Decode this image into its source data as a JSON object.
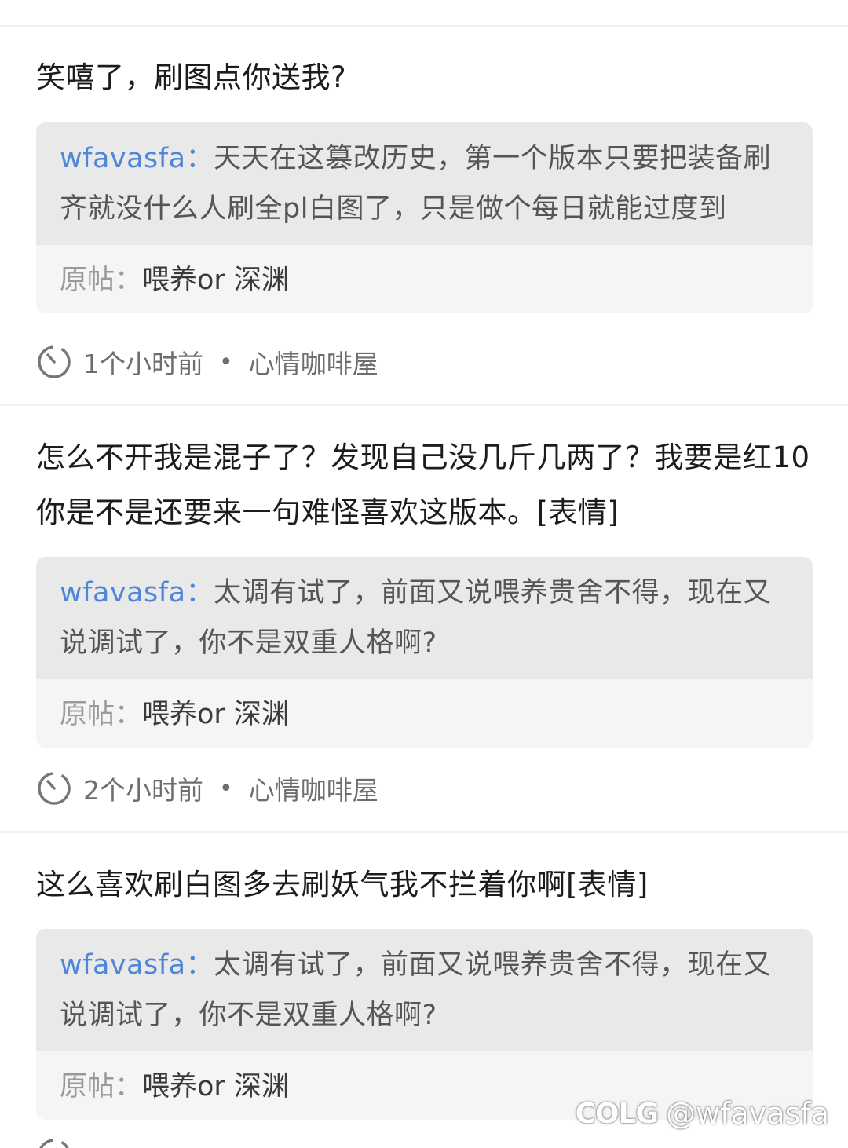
{
  "posts": [
    {
      "reply_text": "笑嘻了，刷图点你送我?",
      "quote": {
        "author": "wfavasfa",
        "colon": "：",
        "text": "天天在这篡改历史，第一个版本只要把装备刷齐就没什么人刷全pl白图了，只是做个每日就能过度到",
        "orig_label": "原帖：",
        "orig_title": "喂养or 深渊"
      },
      "time": "1个小时前",
      "separator": "•",
      "board": "心情咖啡屋"
    },
    {
      "reply_text": "怎么不开我是混子了？发现自己没几斤几两了？我要是红10你是不是还要来一句难怪喜欢这版本。[表情]",
      "quote": {
        "author": "wfavasfa",
        "colon": "：",
        "text": "太调有试了，前面又说喂养贵舍不得，现在又说调试了，你不是双重人格啊?",
        "orig_label": "原帖：",
        "orig_title": "喂养or 深渊"
      },
      "time": "2个小时前",
      "separator": "•",
      "board": "心情咖啡屋"
    },
    {
      "reply_text": "这么喜欢刷白图多去刷妖气我不拦着你啊[表情]",
      "quote": {
        "author": "wfavasfa",
        "colon": "：",
        "text": "太调有试了，前面又说喂养贵舍不得，现在又说调试了，你不是双重人格啊?",
        "orig_label": "原帖：",
        "orig_title": "喂养or 深渊"
      }
    }
  ],
  "watermark": {
    "logo": "COLG",
    "handle": "@wfavasfa"
  },
  "icons": {
    "time": "clock-icon"
  },
  "colors": {
    "author_link": "#4f86d8",
    "quote_top_bg": "#e9e9e9",
    "quote_bottom_bg": "#f5f5f5",
    "text_primary": "#1c1c1c",
    "text_meta": "#6e6e6e"
  }
}
